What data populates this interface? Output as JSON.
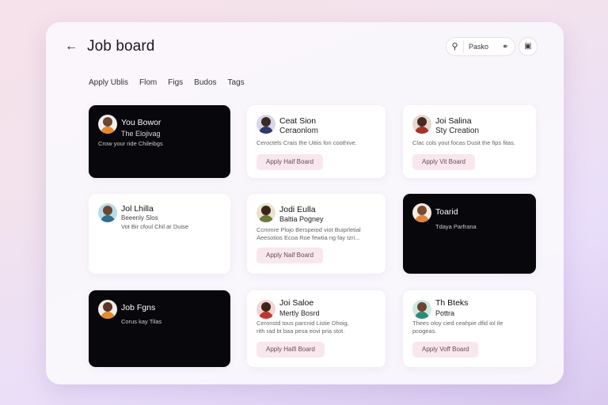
{
  "header": {
    "title": "Job board",
    "search_label": "Pasko"
  },
  "tabs": [
    "Apply Ublis",
    "Flom",
    "Figs",
    "Budos",
    "Tags"
  ],
  "cards": [
    {
      "name": "You Bowor",
      "subtitle": "The Elojivag",
      "desc": "Crow your ride Chileibgs"
    },
    {
      "name": "Ceat Sion",
      "subtitle": "Ceraonlom",
      "desc": "Ceroctels Crais the Uitiis fon coothive.",
      "button": "Apply Haif Board"
    },
    {
      "name": "Joi Salina",
      "subtitle": "Sty Creation",
      "desc": "Clac cols yout focas Dusit the fips fitas.",
      "button": "Apply Vit Board"
    },
    {
      "name": "Jol Lhilla",
      "subtitle": "Beeenly Slos",
      "desc": "Vot Bir cfoul Chil ar Duise"
    },
    {
      "name": "Jodi Eulla",
      "subtitle": "Baltia Pogney",
      "desc": "Ccmmre Plojo Berspeiod viot Buiprletial",
      "desc2": "Aeesotios Ecoa Roe fewtia ng fay tzri...",
      "button": "Apply Naif Board"
    },
    {
      "name": "Toarid",
      "subtitle": "",
      "desc": "Tdaya Parfrana"
    },
    {
      "name": "Job Fgns",
      "subtitle": "",
      "desc": "Corus kay Tilas"
    },
    {
      "name": "Joi Saloe",
      "subtitle": "Mertly Bosrd",
      "desc": "Ceronstd tous parcnid Listie Dhoig,",
      "desc2": "rith rad bt baa pesa eovi pria stot.",
      "button": "Apply Haifi Board"
    },
    {
      "name": "Th Bteks",
      "subtitle": "Pottra",
      "desc": "Thees oloy cied ceahpie dfid iol ile",
      "desc2": "pcogeas.",
      "button": "Apply Voff Board"
    }
  ],
  "colors": {
    "accent_bg": "#f8e7ee",
    "dark_card": "#07070c"
  }
}
